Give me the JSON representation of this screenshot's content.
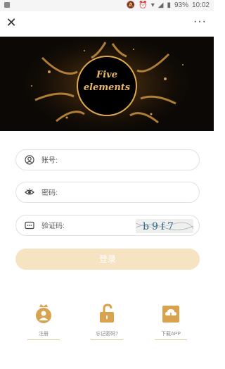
{
  "status": {
    "battery": "93%",
    "time": "10:02"
  },
  "titlebar": {
    "close": "✕",
    "more": "···"
  },
  "banner": {
    "logo_line1": "Five",
    "logo_line2": "elements"
  },
  "form": {
    "account_placeholder": "账号:",
    "password_placeholder": "密码:",
    "captcha_placeholder": "验证码:",
    "captcha_text": "b9f7"
  },
  "login_label": "登录",
  "links": [
    {
      "label": "注册",
      "icon": "user-crown-icon"
    },
    {
      "label": "忘记密码?",
      "icon": "unlock-icon"
    },
    {
      "label": "下载APP",
      "icon": "cloud-download-icon"
    }
  ],
  "colors": {
    "accent": "#d9a24f",
    "button_bg": "#f6e3c1",
    "banner_bg": "#0b0805"
  }
}
